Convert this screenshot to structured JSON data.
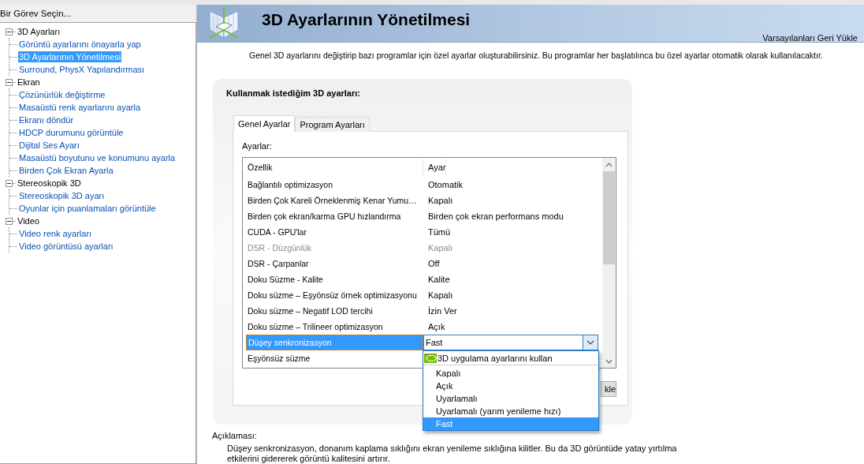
{
  "task_pane": {
    "title": "Bir Görev Seçin...",
    "tree": [
      {
        "label": "3D Ayarları",
        "expanded": true,
        "children": [
          {
            "label": "Görüntü ayarlarını önayarla yap",
            "selected": false
          },
          {
            "label": "3D Ayarlarının Yönetilmesi",
            "selected": true
          },
          {
            "label": "Surround, PhysX Yapılandırması",
            "selected": false
          }
        ]
      },
      {
        "label": "Ekran",
        "expanded": true,
        "children": [
          {
            "label": "Çözünürlük değiştirme",
            "selected": false
          },
          {
            "label": "Masaüstü renk ayarlarını ayarla",
            "selected": false
          },
          {
            "label": "Ekranı döndür",
            "selected": false
          },
          {
            "label": "HDCP durumunu görüntüle",
            "selected": false
          },
          {
            "label": "Dijital Ses Ayarı",
            "selected": false
          },
          {
            "label": "Masaüstü boyutunu ve konumunu ayarla",
            "selected": false
          },
          {
            "label": "Birden Çok Ekran Ayarla",
            "selected": false
          }
        ]
      },
      {
        "label": "Stereoskopik 3D",
        "expanded": true,
        "children": [
          {
            "label": "Stereoskopik 3D ayarı",
            "selected": false
          },
          {
            "label": "Oyunlar için puanlamaları görüntüle",
            "selected": false
          }
        ]
      },
      {
        "label": "Video",
        "expanded": true,
        "children": [
          {
            "label": "Video renk ayarları",
            "selected": false
          },
          {
            "label": "Video görüntüsü ayarları",
            "selected": false
          }
        ]
      }
    ]
  },
  "page": {
    "title": "3D Ayarlarının Yönetilmesi",
    "restore_link": "Varsayılanları Geri Yükle",
    "intro": "Genel 3D ayarlarını değiştirip bazı programlar için özel ayarlar oluşturabilirsiniz. Bu programlar her başlatılınca bu özel ayarlar otomatik olarak kullanılacaktır.",
    "section_title": "Kullanmak istediğim 3D ayarları:",
    "tabs": [
      {
        "label": "Genel Ayarlar",
        "selected": true
      },
      {
        "label": "Program Ayarları",
        "selected": false
      }
    ],
    "settings_label": "Ayarlar:",
    "columns": [
      "Özellik",
      "Ayar"
    ],
    "rows": [
      {
        "feature": "Bağlantılı optimizasyon",
        "value": "Otomatik",
        "disabled": false,
        "selected": false
      },
      {
        "feature": "Birden Çok Kareli Örneklenmiş Kenar Yumu…",
        "value": "Kapalı",
        "disabled": false,
        "selected": false
      },
      {
        "feature": "Birden çok ekran/karma GPU hızlandırma",
        "value": "Birden çok ekran performans modu",
        "disabled": false,
        "selected": false
      },
      {
        "feature": "CUDA - GPU'lar",
        "value": "Tümü",
        "disabled": false,
        "selected": false
      },
      {
        "feature": "DSR - Düzgünlük",
        "value": "Kapalı",
        "disabled": true,
        "selected": false
      },
      {
        "feature": "DSR - Çarpanlar",
        "value": "Off",
        "disabled": false,
        "selected": false
      },
      {
        "feature": "Doku Süzme - Kalite",
        "value": "Kalite",
        "disabled": false,
        "selected": false
      },
      {
        "feature": "Doku süzme – Eşyönsüz örnek optimizasyonu",
        "value": "Kapalı",
        "disabled": false,
        "selected": false
      },
      {
        "feature": "Doku süzme – Negatif LOD tercihi",
        "value": "İzin Ver",
        "disabled": false,
        "selected": false
      },
      {
        "feature": "Doku süzme – Trilineer optimizasyon",
        "value": "Açık",
        "disabled": false,
        "selected": false
      },
      {
        "feature": "Düşey senkronizasyon",
        "value": "Fast",
        "disabled": false,
        "selected": true
      },
      {
        "feature": "Eşyönsüz süzme",
        "value": "",
        "disabled": false,
        "selected": false
      }
    ],
    "dropdown_options": [
      {
        "label": "3D uygulama ayarlarını kullan",
        "kind": "app",
        "selected": false
      },
      {
        "label": "Kapalı",
        "kind": "plain",
        "selected": false
      },
      {
        "label": "Açık",
        "kind": "plain",
        "selected": false
      },
      {
        "label": "Uyarlamalı",
        "kind": "plain",
        "selected": false
      },
      {
        "label": "Uyarlamalı (yarım yenileme hızı)",
        "kind": "plain",
        "selected": false
      },
      {
        "label": "Fast",
        "kind": "plain",
        "selected": true
      }
    ],
    "partial_button": "kle",
    "description_label": "Açıklaması:",
    "description": "Düşey senkronizasyon, donanım kaplama sıklığını ekran yenileme sıklığına kilitler. Bu da 3D görüntüde yatay yırtılma etkilerini gidererek görüntü kalitesini artırır."
  }
}
